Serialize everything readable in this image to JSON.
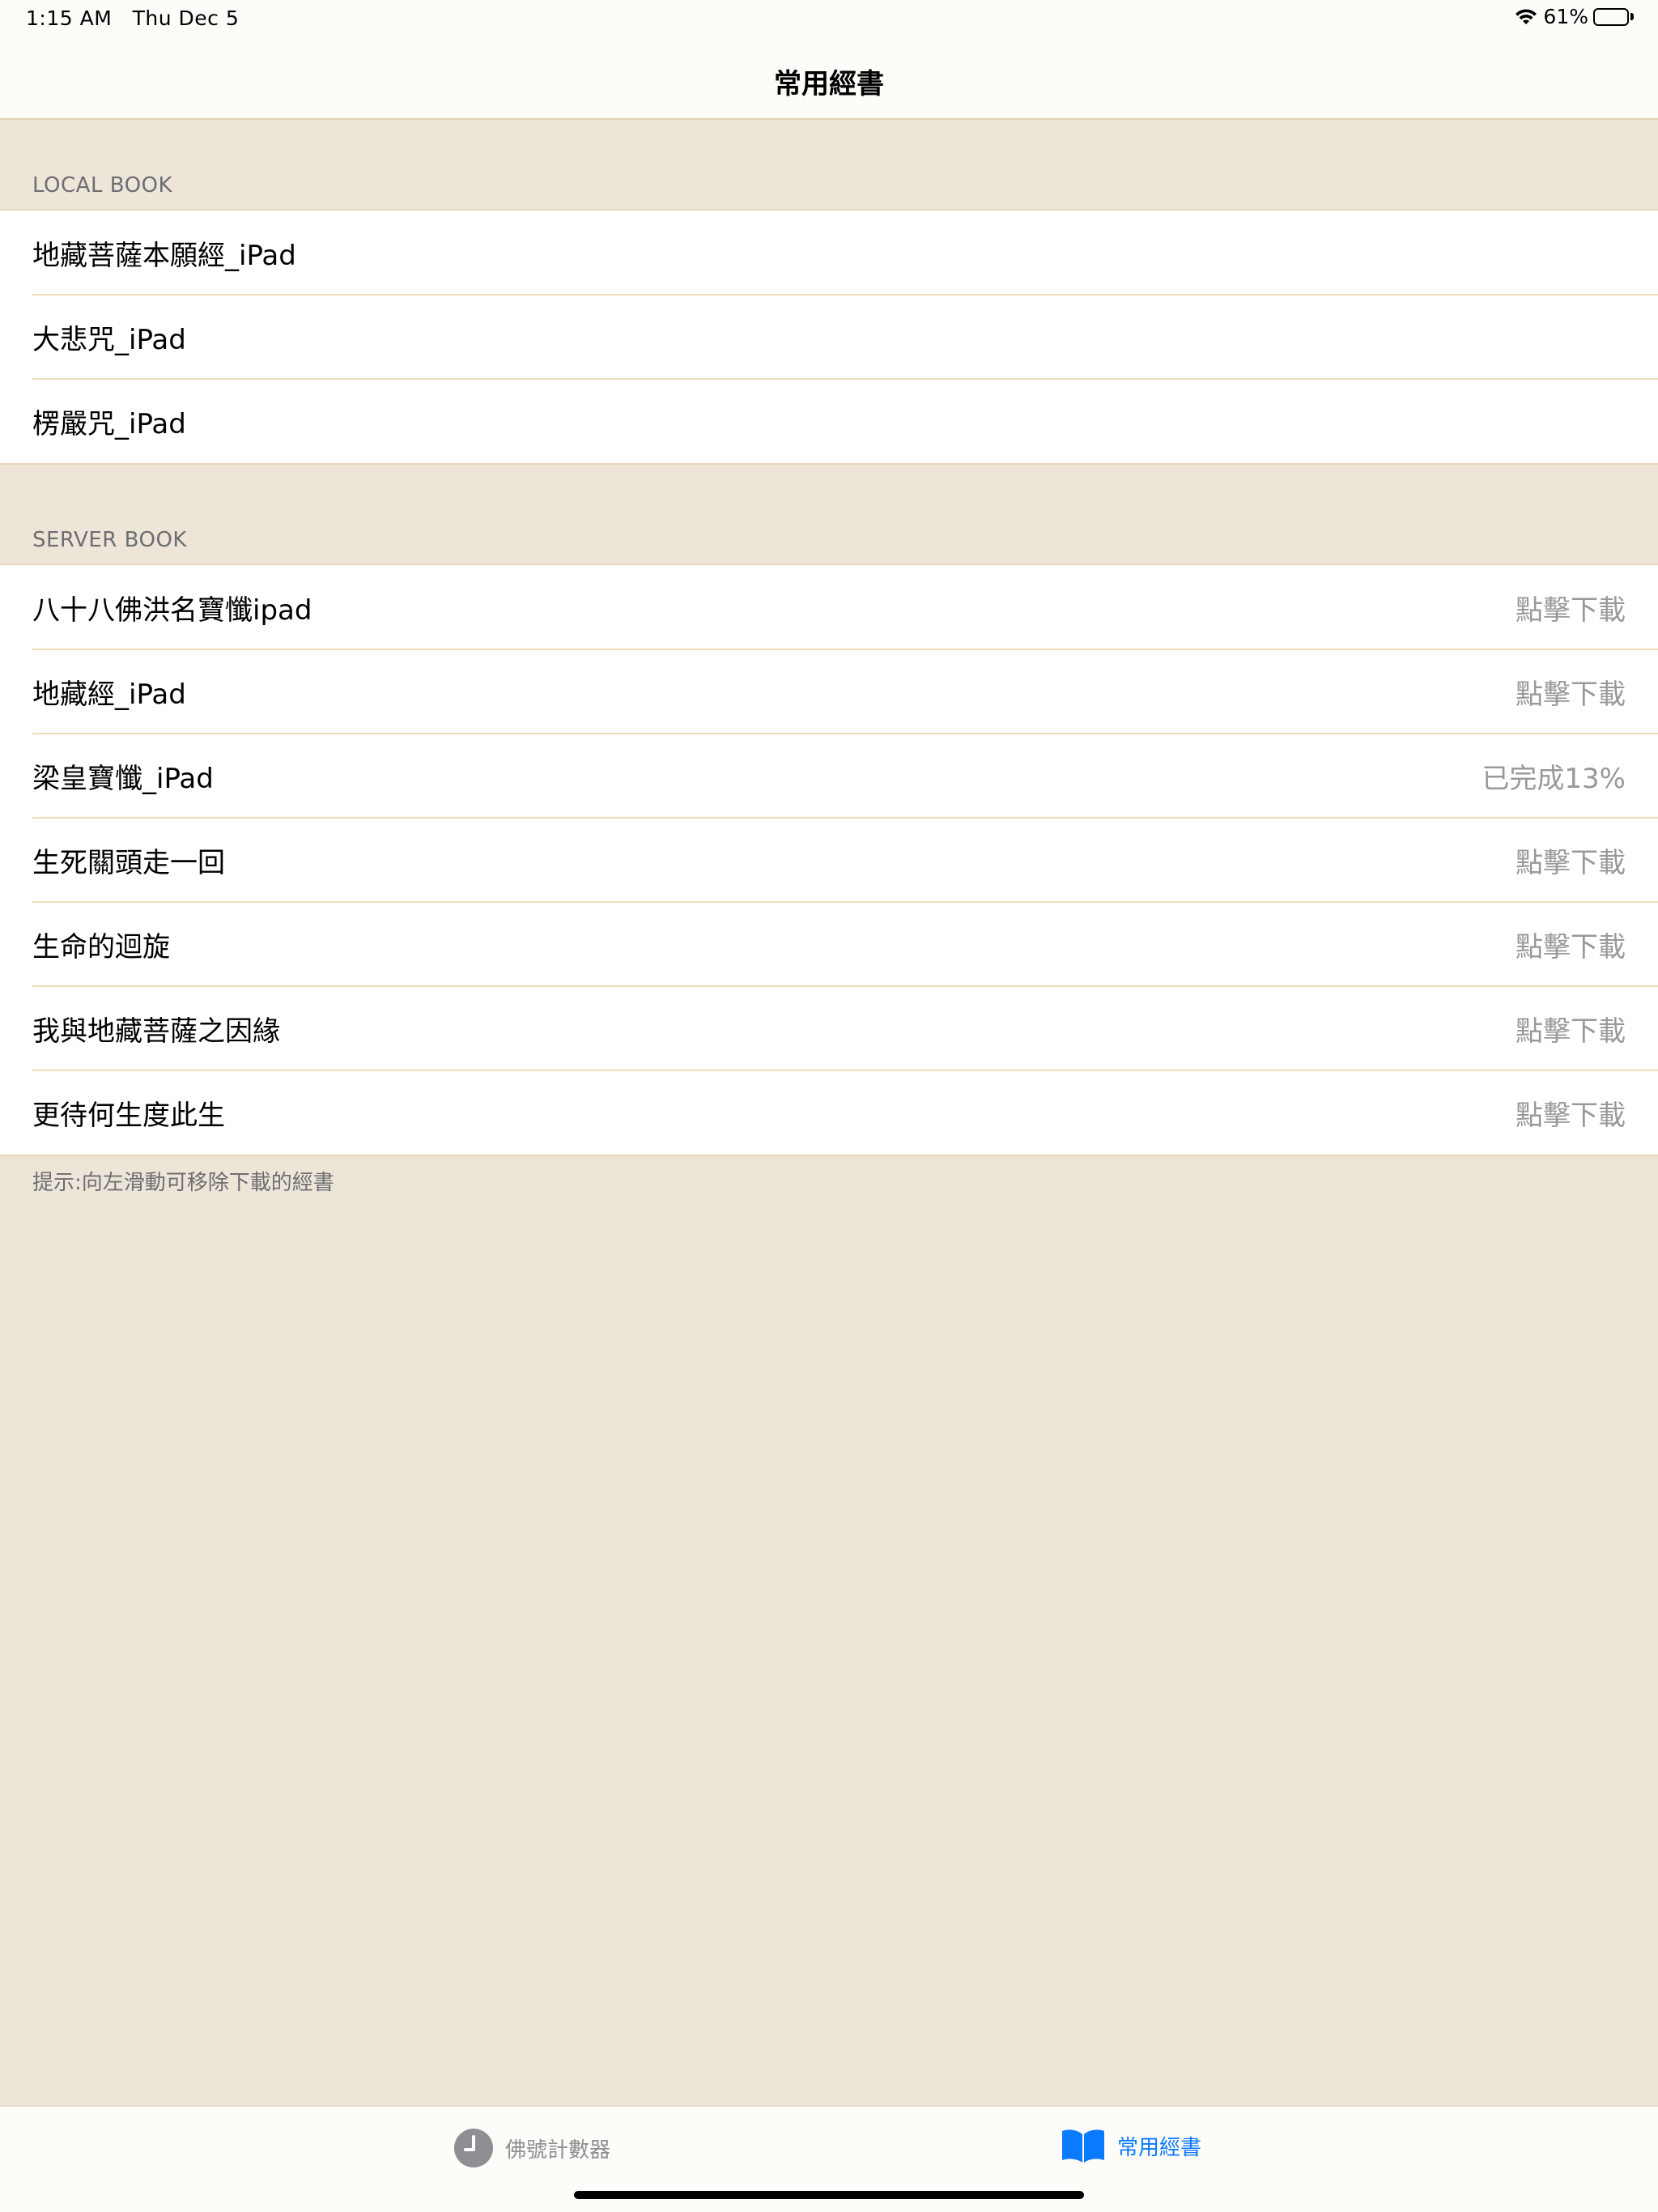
{
  "status_bar": {
    "time": "1:15 AM   Thu Dec 5",
    "battery": "61%",
    "battery_level": 0.61
  },
  "nav": {
    "title": "常用經書"
  },
  "local_section": {
    "header": "LOCAL BOOK",
    "items": [
      {
        "title": "地藏菩薩本願經_iPad"
      },
      {
        "title": "大悲咒_iPad"
      },
      {
        "title": "楞嚴咒_iPad"
      }
    ]
  },
  "server_section": {
    "header": "SERVER BOOK",
    "items": [
      {
        "title": "八十八佛洪名寶懺ipad",
        "status": "點擊下載"
      },
      {
        "title": "地藏經_iPad",
        "status": "點擊下載"
      },
      {
        "title": "梁皇寶懺_iPad",
        "status": "已完成13%"
      },
      {
        "title": "生死關頭走一回",
        "status": "點擊下載"
      },
      {
        "title": "生命的迴旋",
        "status": "點擊下載"
      },
      {
        "title": "我與地藏菩薩之因緣",
        "status": "點擊下載"
      },
      {
        "title": "更待何生度此生",
        "status": "點擊下載"
      }
    ],
    "footer": "提示:向左滑動可移除下載的經書"
  },
  "tab_bar": {
    "tabs": [
      {
        "label": "佛號計數器",
        "icon": "clock-icon",
        "selected": false
      },
      {
        "label": "常用經書",
        "icon": "book-icon",
        "selected": true
      }
    ],
    "active_color": "#0a7aff",
    "inactive_color": "#8e8e93"
  }
}
